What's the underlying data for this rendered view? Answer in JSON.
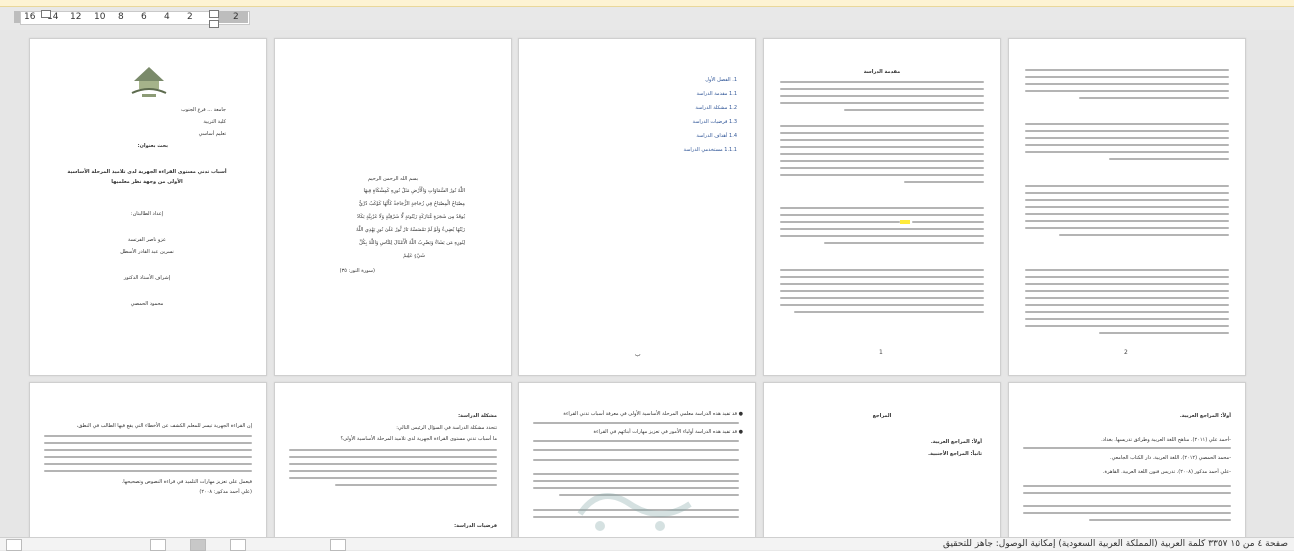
{
  "ruler": {
    "numbers": [
      "16",
      "14",
      "12",
      "10",
      "8",
      "6",
      "4",
      "2",
      "2"
    ]
  },
  "page1": {
    "univ": "جامعة ...  فرع الجنوب",
    "college": "كلية التربية",
    "dept": "تعليم أساسي",
    "research_title_label": "بحث بعنوان:",
    "title_l1": "أسباب تدني مستوى القراءة الجهرية لدى تلاميذ المرحلة الأساسية",
    "title_l2": "الأولى من وجهة نظر معلميها",
    "prepared_by": "إعداد الطالبتان:",
    "student1": "عزو ناصر الفرتسة",
    "student2": "نسرين عبد القادر الأسطل",
    "supervisor_label": "إشراف الأستاذ الدكتور",
    "supervisor": "محمود الحمصي"
  },
  "page2": {
    "basmala": "بسم الله الرحمن الرحيم",
    "v1": "اللَّهُ نُورُ السَّمَاوَاتِ وَالْأَرْضِ  مَثَلُ نُورِهِ كَمِشْكَاةٍ فِيهَا",
    "v2": "مِصْبَاحٌ الْمِصْبَاحُ فِي زُجَاجَةٍ الزُّجَاجَةُ كَأَنَّهَا كَوْكَبٌ دُرِّيٌّ",
    "v3": "يُوقَدُ مِن شَجَرَةٍ مُّبَارَكَةٍ زَيْتُونَةٍ لَّا شَرْقِيَّةٍ وَلَا غَرْبِيَّةٍ يَكَادُ",
    "v4": "زَيْتُهَا يُضِيءُ وَلَوْ لَمْ تَمْسَسْهُ نَارٌ  نُّورٌ  عَلَىٰ نُورٍ  يَهْدِي اللَّهُ",
    "v5": "لِنُورِهِ مَن يَشَاءُ  وَيَضْرِبُ اللَّهُ الْأَمْثَالَ لِلنَّاسِ  وَاللَّهُ بِكُلِّ",
    "v6": "شَيْءٍ عَلِيمٌ",
    "ref": "(سورة النور: ٣٥)"
  },
  "page3": {
    "toc": [
      "1.  الفصل الأول",
      "1.1   مقدمة الدراسة",
      "1.2   مشكلة الدراسة",
      "1.3   فرضيات الدراسة",
      "1.4   أهداف الدراسة",
      "1.1.1   مستخدمي الدراسة"
    ],
    "page_no": "ب"
  },
  "page4": {
    "heading": "مقدمة الدراسة",
    "page_no": "1"
  },
  "page5": {
    "page_no": "2"
  },
  "row2": {
    "p6": {
      "l1": "إن القراءة الجهرية تيسر للمعلم الكشف عن الأخطاء التي يقع فيها الطالب في النطق،",
      "l2": "فيعمل على تعزيز مهارات التلميذ في قراءة النصوص وتصحيحها.",
      "ref": "(علي أحمد مدكور: ٢٠٠٨)"
    },
    "p7": {
      "heading": "مشكلة الدراسة:",
      "l1": "تتحدد مشكلة الدراسة في السؤال الرئيس التالي:",
      "l2": "ما أسباب تدني مستوى القراءة الجهرية لدى تلاميذ المرحلة الأساسية الأولى؟",
      "hyp": "فرضيات الدراسة:"
    },
    "p8": {
      "l1": "● قد تفيد هذه الدراسة معلمي المرحلة الأساسية الأولى في معرفة أسباب تدني القراءة",
      "l2": "● قد تفيد هذه الدراسة أولياء الأمور في تعزيز مهارات أبنائهم في القراءة"
    },
    "p9": {
      "heading": "المراجع",
      "l1": "أولاً: المراجع العربية.",
      "l2": "ثانياً: المراجع الأجنبية."
    },
    "p10": {
      "heading": "أولاً: المراجع العربية.",
      "l1": "-أحمد علي (٢٠١١). مناهج اللغة العربية وطرائق تدريسها. بغداد.",
      "l2": "-محمد الحمصي (٢٠١٢). اللغة العربية. دار الكتاب الجامعي.",
      "l3": "-علي أحمد مدكور (٢٠٠٨). تدريس فنون اللغة العربية. القاهرة."
    }
  },
  "status": {
    "text": "صفحة ٤ من ١٥   ٣٣٥٧ كلمة   العربية (المملكة العربية السعودية)   إمكانية الوصول: جاهز للتحقيق"
  },
  "colors": {
    "ruler_bg": "#e8e8e8",
    "page_bg": "#ffffff",
    "toc_blue": "#2f5597",
    "highlight": "#ffeb3b"
  }
}
